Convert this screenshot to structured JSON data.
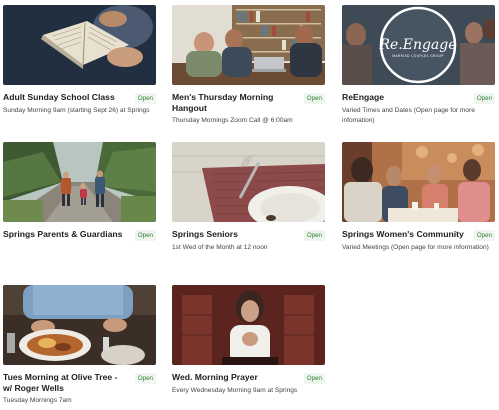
{
  "groups": [
    {
      "title": "Adult Sunday School Class",
      "status": "Open",
      "subtitle": "Sunday Morning 9am (starting Sept 26) at Springs"
    },
    {
      "title": "Men's Thursday Morning Hangout",
      "status": "Open",
      "subtitle": "Thursday Mornings Zoom Call @ 6:00am"
    },
    {
      "title": "ReEngage",
      "status": "Open",
      "subtitle": "Varied Times and Dates (Open page for more infomation)",
      "image_logo_text": "Re.Engage",
      "image_logo_subtext": "MARRIED COUPLES GROUP"
    },
    {
      "title": "Springs Parents & Guardians",
      "status": "Open",
      "subtitle": ""
    },
    {
      "title": "Springs Seniors",
      "status": "Open",
      "subtitle": "1st Wed of the Month at 12 noon"
    },
    {
      "title": "Springs Women's Community",
      "status": "Open",
      "subtitle": "Varied Meetings (Open page for more information)"
    },
    {
      "title": "Tues Morning at Olive Tree - w/ Roger Wells",
      "status": "Open",
      "subtitle": "Tuesday Mornings 7am"
    },
    {
      "title": "Wed. Morning Prayer",
      "status": "Open",
      "subtitle": "Every Wednesday Morning 9am at Springs"
    }
  ],
  "colors": {
    "status_text": "#2e7d32",
    "status_bg": "#eef6ef",
    "title": "#1e1e1e"
  }
}
